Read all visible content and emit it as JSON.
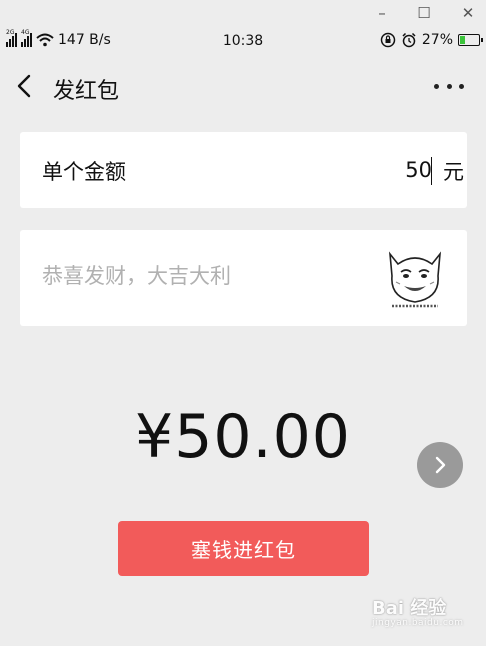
{
  "window_controls": {
    "minimize": "–",
    "maximize": "☐",
    "close": "✕"
  },
  "status_bar": {
    "net_2g": "2G",
    "net_4g": "4G",
    "speed": "147 B/s",
    "time": "10:38",
    "battery": "27%",
    "battery_level": 0.27,
    "icons": [
      "signal-icon",
      "wifi-icon",
      "rotation-lock-icon",
      "alarm-icon",
      "battery-charging-icon"
    ]
  },
  "nav": {
    "title": "发红包",
    "back_icon": "chevron-left-icon",
    "more_icon": "more-dots-icon"
  },
  "amount": {
    "label": "单个金额",
    "value": "50",
    "unit": "元"
  },
  "message": {
    "placeholder": "恭喜发财，大吉大利",
    "sticker_icon": "meme-sticker-icon"
  },
  "total": "¥50.00",
  "send_button": "塞钱进红包",
  "watermark": {
    "brand": "Bai 经验",
    "url": "jingyan.baidu.com"
  },
  "colors": {
    "background": "#ededed",
    "button_red": "#f25b5a",
    "placeholder_gray": "#b1b1b1",
    "float_button_gray": "#9a9a9a"
  }
}
